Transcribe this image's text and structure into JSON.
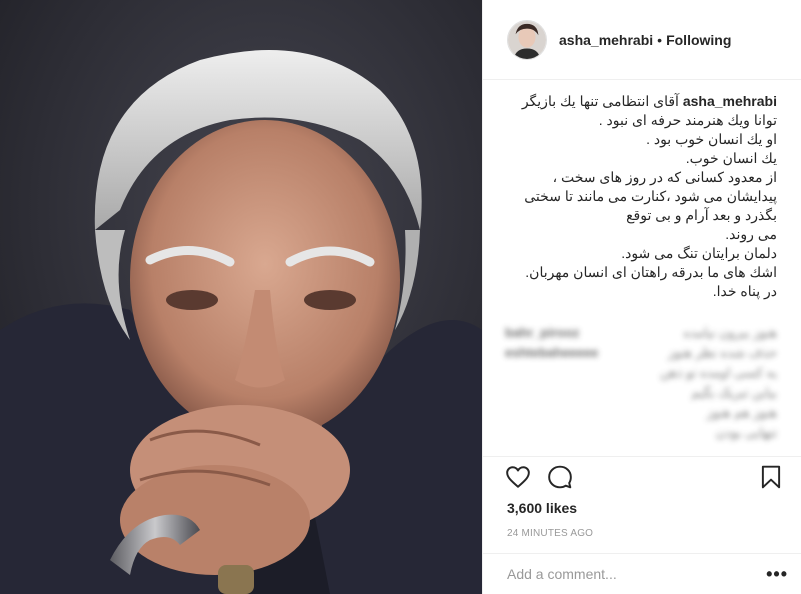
{
  "post": {
    "image_alt": "Portrait photo",
    "colors": {
      "background": "#2c2c33",
      "hair": "#d9d9d9",
      "skin": "#c79780",
      "suit": "#2a2b3b"
    }
  },
  "header": {
    "username": "asha_mehrabi",
    "separator": "•",
    "follow_label": "Following",
    "avatar_icon": "avatar-icon"
  },
  "caption": {
    "username": "asha_mehrabi",
    "lines": [
      "آقای انتظامی تنها یك بازیگر",
      "توانا ویك هنرمند حرفه ای نبود .",
      "او یك انسان خوب بود .",
      "یك انسان خوب.",
      "از معدود کسانی که در روز های سخت ،",
      "پیدایشان می شود ،کنارت می مانند تا سختی",
      "بگذرد و بعد آرام و بی توقع",
      "می روند.",
      "دلمان برایتان تنگ می شود.",
      "اشك های ما بدرقه راهتان ای انسان مهربان.",
      "در پناه خدا."
    ]
  },
  "blurred_comments": [
    {
      "user": "bahr_pirooz",
      "text": "هنوز بیرون نیامده"
    },
    {
      "user": "eshtebaheeeee",
      "text": "حذف شده نظر هنوز"
    },
    {
      "user": "",
      "text": "یه کسی اومده تو ذهن"
    },
    {
      "user": "",
      "text": "بیاین تبریک بگیم"
    },
    {
      "user": "",
      "text": "هنوز هم هنوز"
    },
    {
      "user": "",
      "text": "تنهایی بودن"
    }
  ],
  "actions": {
    "like_icon": "heart-icon",
    "comment_icon": "comment-icon",
    "save_icon": "bookmark-icon"
  },
  "likes_text": "3,600 likes",
  "timestamp": "24 MINUTES AGO",
  "add_comment": {
    "placeholder": "Add a comment...",
    "more_label": "•••"
  }
}
